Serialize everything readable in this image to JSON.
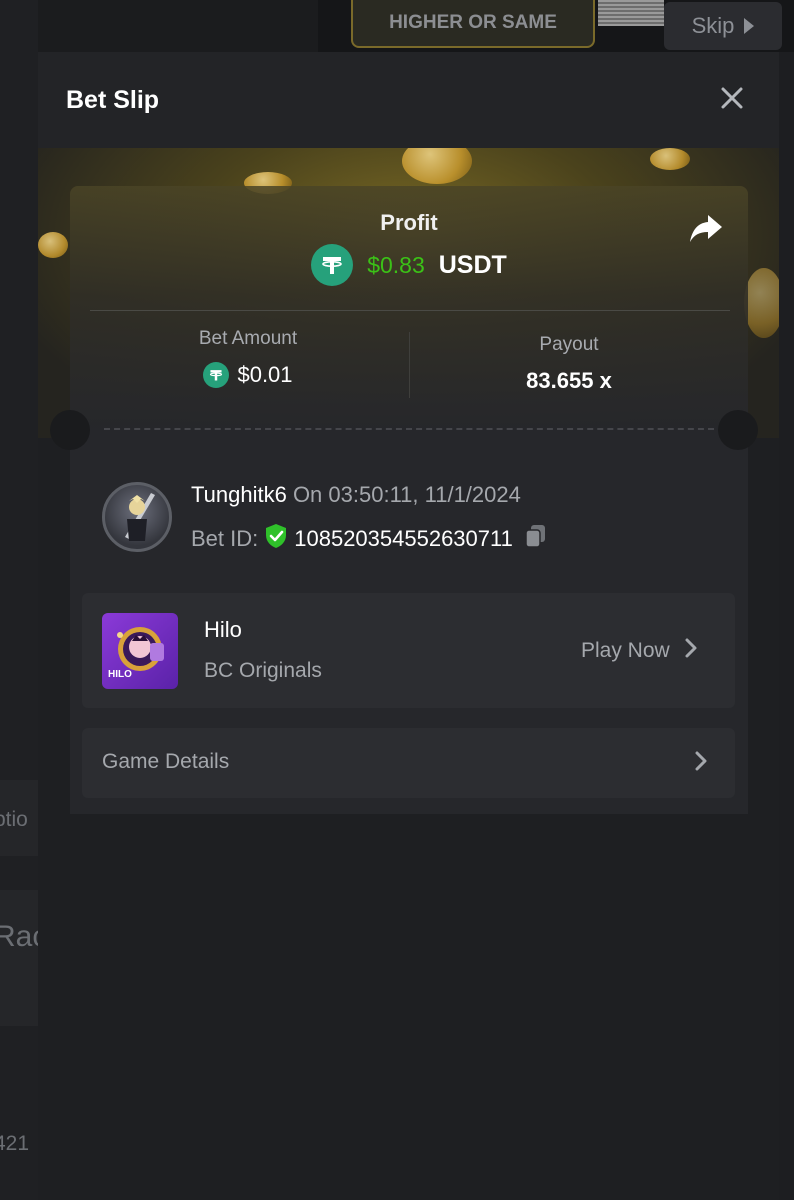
{
  "background": {
    "game_button_label": "HIGHER OR SAME",
    "skip_label": "Skip",
    "side_texts": [
      "ptio",
      "Rac",
      "421"
    ]
  },
  "modal": {
    "title": "Bet Slip"
  },
  "profit": {
    "label": "Profit",
    "value": "$0.83",
    "currency": "USDT"
  },
  "stats": {
    "bet_amount_label": "Bet Amount",
    "bet_amount_value": "$0.01",
    "payout_label": "Payout",
    "payout_value": "83.655 x"
  },
  "user": {
    "name": "Tunghitk6",
    "date": "On 03:50:11, 11/1/2024",
    "bet_id_label": "Bet ID:",
    "bet_id_value": "108520354552630711"
  },
  "game": {
    "name": "Hilo",
    "provider": "BC Originals",
    "play_label": "Play Now",
    "thumb_label": "HILO"
  },
  "details": {
    "label": "Game Details"
  },
  "colors": {
    "profit_green": "#3bc117",
    "usdt_green": "#26a17b",
    "shield_green": "#2fc12a"
  },
  "icons": [
    "close-icon",
    "share-icon",
    "usdt-icon",
    "shield-check-icon",
    "copy-icon",
    "chevron-right-icon"
  ]
}
